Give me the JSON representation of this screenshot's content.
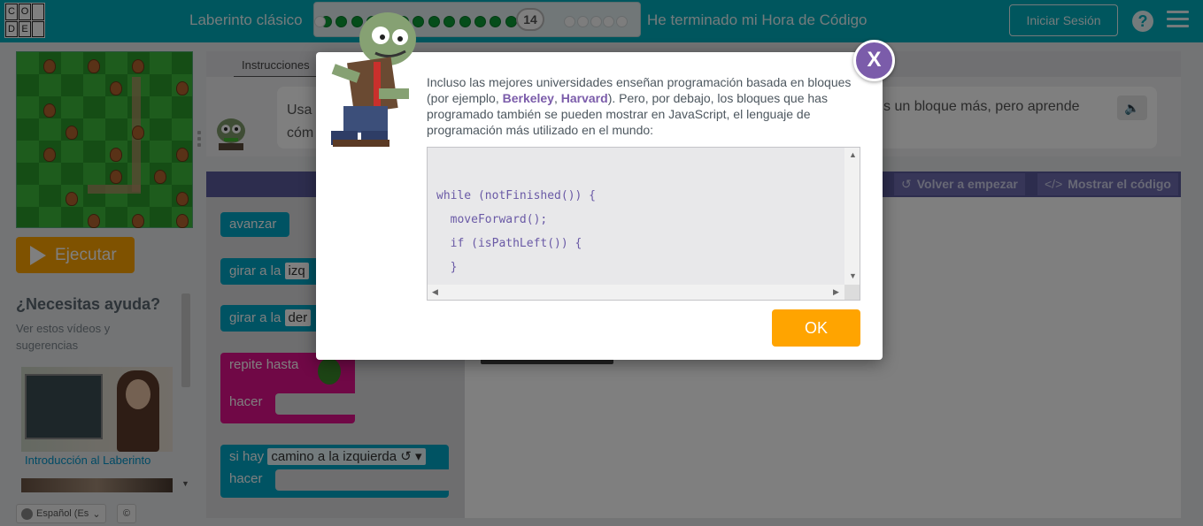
{
  "header": {
    "logo_letters": [
      "C",
      "O",
      "",
      "D",
      "E",
      ""
    ],
    "level_title": "Laberinto clásico",
    "progress": {
      "completed": 14,
      "total": 20,
      "current_level_label": "14"
    },
    "finish_link": "He terminado mi Hora de Código",
    "signin_label": "Iniciar Sesión",
    "help_icon": "question-icon",
    "menu_icon": "hamburger-icon"
  },
  "left": {
    "run_label": "Ejecutar",
    "help_title": "¿Necesitas ayuda?",
    "help_subtitle": "Ver estos vídeos y sugerencias",
    "video_label": "Introducción al Laberinto",
    "language_value": "Español (Es",
    "cc_label": "©"
  },
  "instructions": {
    "tab_label": "Instrucciones",
    "text_left": "Usa cóm",
    "text_right": "s un bloque más, pero aprende"
  },
  "workspace_header": {
    "reset_label": "Volver a empezar",
    "show_code_label": "Mostrar el código"
  },
  "toolbox": {
    "move_forward": "avanzar",
    "turn_left_prefix": "girar a la",
    "turn_left_value": "izq",
    "turn_right_prefix": "girar a la",
    "turn_right_value": "der",
    "repeat_until": "repite hasta",
    "do": "hacer",
    "if_path": "si hay",
    "if_path_value": "camino a la izquierda ↺ ▾",
    "if_do": "hacer"
  },
  "dialog": {
    "close_label": "X",
    "text_part1": "Incluso las mejores universidades enseñan programación basada en bloques (por ejemplo, ",
    "berkeley": "Berkeley",
    "comma": ", ",
    "harvard": "Harvard",
    "text_part2": "). Pero, por debajo, los bloques que has programado también se pueden mostrar en JavaScript, el lenguaje de programación más utilizado en el mundo:",
    "code_lines": [
      "while (notFinished()) {",
      "  moveForward();",
      "  if (isPathLeft()) {",
      "  }",
      "}"
    ],
    "ok_label": "OK"
  }
}
